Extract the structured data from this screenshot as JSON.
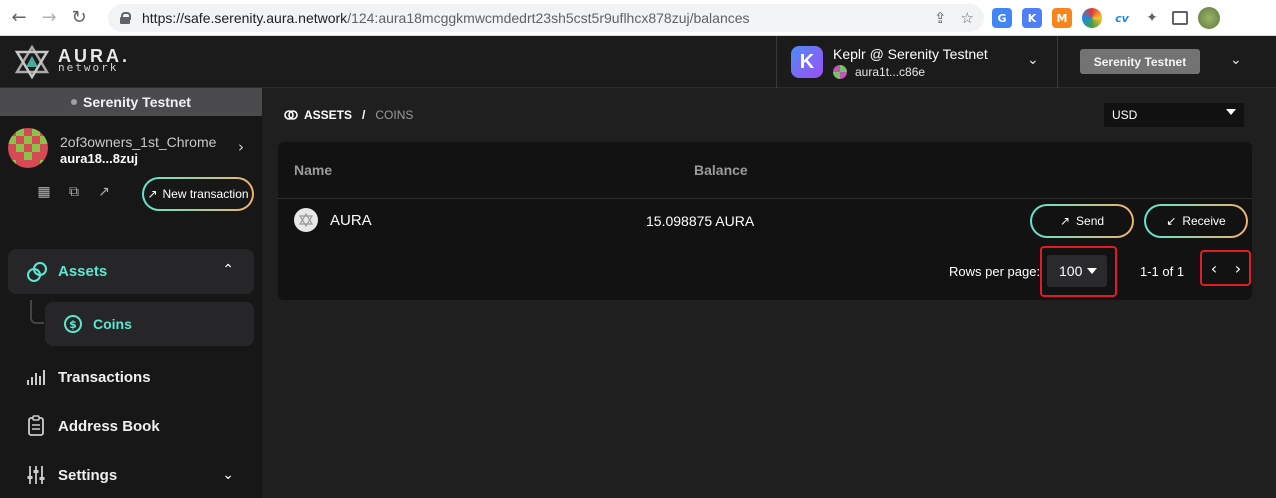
{
  "browser": {
    "url_host": "https://safe.serenity.aura.network",
    "url_path": "/124:aura18mcggkmwcmdedrt23sh5cst5r9uflhcx878zuj/balances"
  },
  "header": {
    "logo_line1": "AURA.",
    "logo_line2": "network",
    "wallet_name": "Keplr @ Serenity Testnet",
    "wallet_address": "aura1t...c86e",
    "keplr_letter": "K",
    "network_button": "Serenity Testnet"
  },
  "sidebar": {
    "network": "Serenity Testnet",
    "owner_name": "2of3owners_1st_Chrome",
    "owner_address": "aura18...8zuj",
    "new_transaction": "New transaction",
    "assets": "Assets",
    "coins": "Coins",
    "transactions": "Transactions",
    "address_book": "Address Book",
    "settings": "Settings"
  },
  "main": {
    "breadcrumb_root": "ASSETS",
    "breadcrumb_sep": "/",
    "breadcrumb_current": "COINS",
    "currency": "USD",
    "table": {
      "col_name": "Name",
      "col_balance": "Balance",
      "rows": [
        {
          "name": "AURA",
          "balance": "15.098875 AURA"
        }
      ],
      "send": "Send",
      "receive": "Receive",
      "rows_per_page_label": "Rows per page:",
      "rows_per_page_value": "100",
      "range": "1-1 of 1"
    }
  },
  "colors": {
    "accent": "#5ee6d0",
    "highlight": "#e11d24"
  }
}
